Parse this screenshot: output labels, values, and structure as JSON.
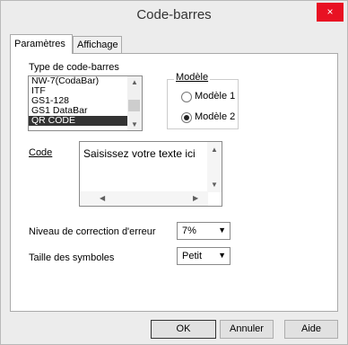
{
  "window": {
    "title": "Code-barres",
    "close_symbol": "×"
  },
  "tabs": [
    {
      "label": "Paramètres"
    },
    {
      "label": "Affichage"
    }
  ],
  "barcode_type": {
    "label": "Type de code-barres",
    "items": [
      "NW-7(CodaBar)",
      "ITF",
      "GS1-128",
      "GS1 DataBar",
      "QR CODE"
    ],
    "selected": "QR CODE"
  },
  "model": {
    "legend": "Modèle",
    "options": [
      {
        "label": "Modèle 1"
      },
      {
        "label": "Modèle 2"
      }
    ],
    "selected": "Modèle 2"
  },
  "code": {
    "label": "Code",
    "value": "Saisissez votre texte ici"
  },
  "correction": {
    "label": "Niveau de correction d'erreur",
    "value": "7%"
  },
  "symbol_size": {
    "label": "Taille des symboles",
    "value": "Petit"
  },
  "buttons": {
    "ok": "OK",
    "cancel": "Annuler",
    "help": "Aide"
  }
}
